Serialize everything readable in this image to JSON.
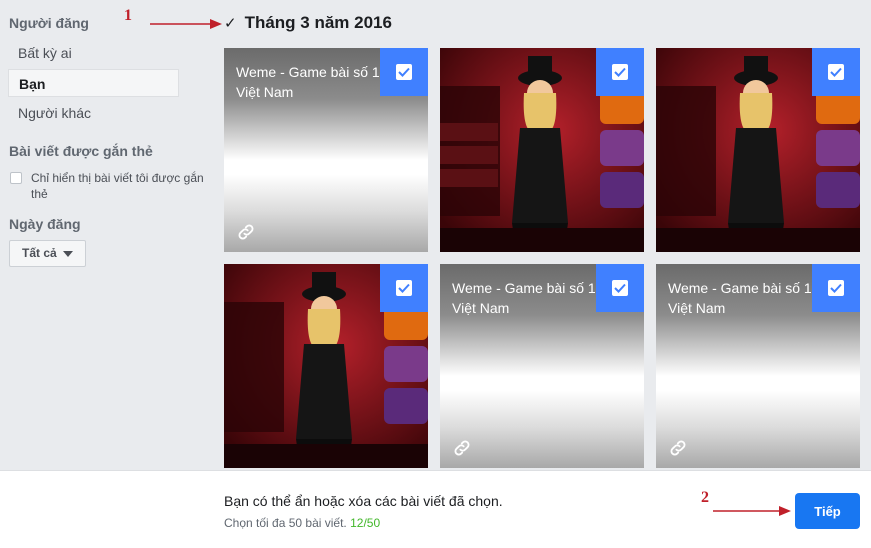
{
  "sidebar": {
    "poster_heading": "Người đăng",
    "poster_options": [
      "Bất kỳ ai",
      "Bạn",
      "Người khác"
    ],
    "tagged_heading": "Bài viết được gắn thẻ",
    "tagged_checkbox_label": "Chỉ hiển thị bài viết tôi được gắn thẻ",
    "date_heading": "Ngày đăng",
    "date_dropdown": "Tất cả"
  },
  "main": {
    "month_title": "Tháng 3 năm 2016",
    "posts": [
      {
        "kind": "link",
        "title": "Weme - Game bài số 1 Việt Nam"
      },
      {
        "kind": "photo",
        "title": ""
      },
      {
        "kind": "photo",
        "title": ""
      },
      {
        "kind": "photo",
        "title": ""
      },
      {
        "kind": "link",
        "title": "Weme - Game bài số 1 Việt Nam"
      },
      {
        "kind": "link",
        "title": "Weme - Game bài số 1 Việt Nam"
      }
    ]
  },
  "footer": {
    "message": "Bạn có thể ẩn hoặc xóa các bài viết đã chọn.",
    "limit_text": "Chọn tối đa 50 bài viết.",
    "count": "12/50",
    "next_label": "Tiếp"
  },
  "annotations": {
    "one": "1",
    "two": "2"
  },
  "colors": {
    "accent_blue": "#1877f2",
    "select_blue": "#4080ff",
    "count_green": "#42b72a",
    "annotation_red": "#c0202a"
  }
}
